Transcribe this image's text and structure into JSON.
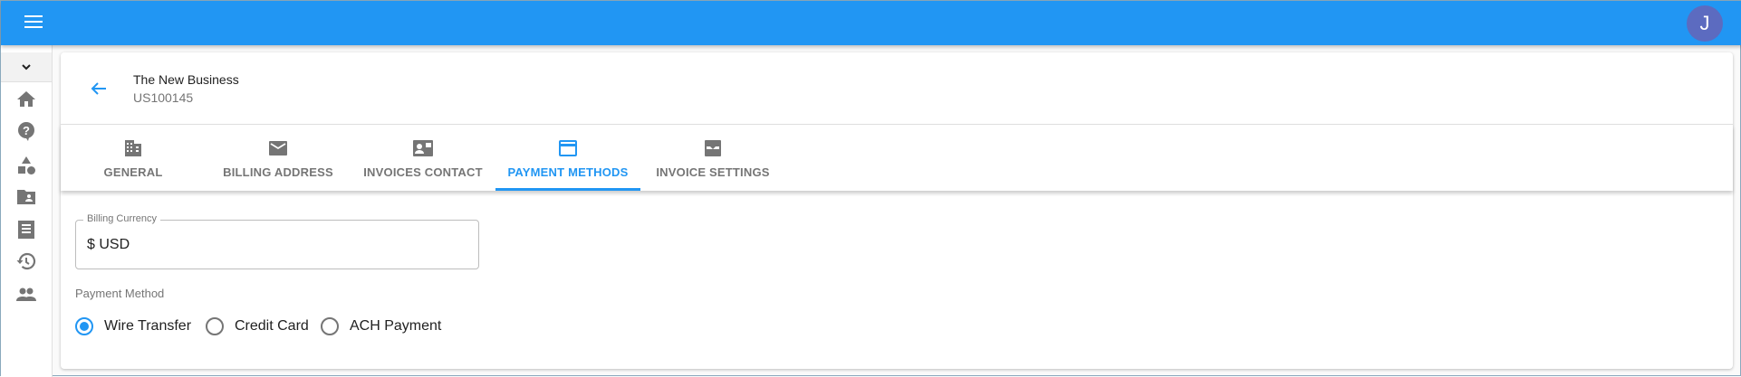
{
  "topbar": {
    "avatar_initial": "J",
    "accent": "#2196f3"
  },
  "header": {
    "title": "The New Business",
    "subtitle": "US100145"
  },
  "tabs": [
    {
      "label": "GENERAL",
      "icon": "building-icon"
    },
    {
      "label": "BILLING ADDRESS",
      "icon": "mail-icon"
    },
    {
      "label": "INVOICES CONTACT",
      "icon": "contact-mail-icon"
    },
    {
      "label": "PAYMENT METHODS",
      "icon": "credit-card-icon",
      "active": true
    },
    {
      "label": "INVOICE SETTINGS",
      "icon": "inbox-icon"
    }
  ],
  "form": {
    "currency_label": "Billing Currency",
    "currency_value": "$ USD",
    "payment_method_label": "Payment Method",
    "options": [
      {
        "label": "Wire Transfer",
        "selected": true
      },
      {
        "label": "Credit Card",
        "selected": false
      },
      {
        "label": "ACH Payment",
        "selected": false
      }
    ]
  }
}
